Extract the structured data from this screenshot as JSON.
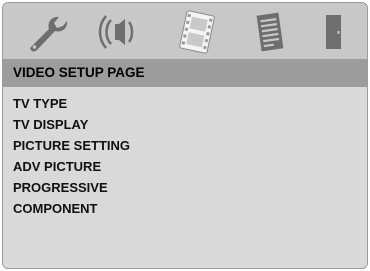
{
  "tabs": [
    {
      "icon": "wrench-icon",
      "name": "general"
    },
    {
      "icon": "speaker-icon",
      "name": "audio"
    },
    {
      "icon": "film-icon",
      "name": "video",
      "active": true
    },
    {
      "icon": "document-icon",
      "name": "preference"
    },
    {
      "icon": "door-icon",
      "name": "exit"
    }
  ],
  "header": {
    "title": "VIDEO SETUP PAGE"
  },
  "menu": {
    "items": [
      {
        "label": "TV TYPE"
      },
      {
        "label": "TV DISPLAY"
      },
      {
        "label": "PICTURE SETTING"
      },
      {
        "label": "ADV PICTURE"
      },
      {
        "label": "PROGRESSIVE"
      },
      {
        "label": "COMPONENT"
      }
    ]
  },
  "colors": {
    "panel": "#d7d7d7",
    "iconbar": "#c8c8c8",
    "header": "#9c9c9c",
    "icon": "#6e6e6e",
    "icon_active": "#f4f4f4"
  }
}
